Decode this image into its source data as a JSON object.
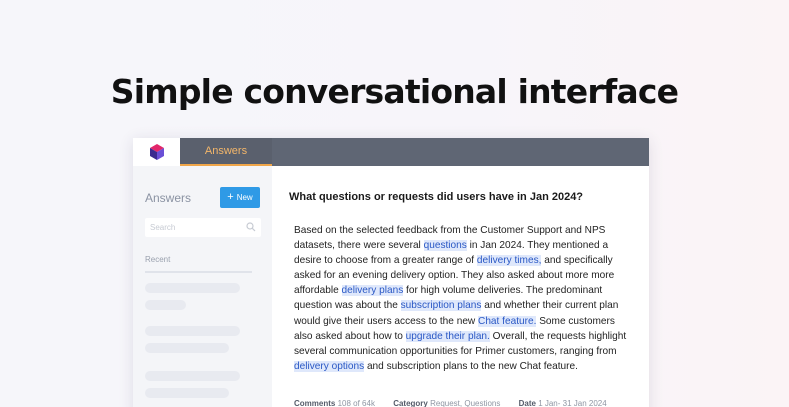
{
  "headline": "Simple conversational interface",
  "nav": {
    "active_tab": "Answers"
  },
  "sidebar": {
    "title": "Answers",
    "new_button": "New",
    "new_icon": "plus-icon",
    "search_placeholder": "Search",
    "recent_label": "Recent"
  },
  "main": {
    "question": "What questions or requests did users have in Jan 2024?",
    "answer_parts": [
      {
        "t": "Based on the selected feedback from the Customer Support and NPS datasets, there were several "
      },
      {
        "t": "questions",
        "hl": true
      },
      {
        "t": " in Jan 2024. They mentioned a desire to choose from a greater range of "
      },
      {
        "t": "delivery times,",
        "hl": true
      },
      {
        "t": " and specifically asked for an evening delivery option. They also asked about more more affordable "
      },
      {
        "t": "delivery plans",
        "hl": true
      },
      {
        "t": " for high volume deliveries. The predominant question was about the "
      },
      {
        "t": "subscription plans",
        "hl": true
      },
      {
        "t": " and whether their current plan would give their users access to the new "
      },
      {
        "t": "Chat feature.",
        "hl": true
      },
      {
        "t": " Some customers also asked about how to "
      },
      {
        "t": "upgrade their plan.",
        "hl": true
      },
      {
        "t": " Overall, the requests highlight several communication opportunities for Primer customers, ranging from "
      },
      {
        "t": "delivery options",
        "hl": true
      },
      {
        "t": " and subscription plans to the new Chat feature."
      }
    ],
    "meta": {
      "comments_label": "Comments",
      "comments_value": "108 of 64k",
      "category_label": "Category",
      "category_value": "Request, Questions",
      "date_label": "Date",
      "date_value": "1 Jan- 31 Jan 2024"
    }
  },
  "colors": {
    "topbar": "#5f6674",
    "accent_orange": "#f0a64a",
    "button_blue": "#2f9ae6",
    "highlight_bg": "#dfe8fb",
    "highlight_text": "#2a58c5"
  }
}
